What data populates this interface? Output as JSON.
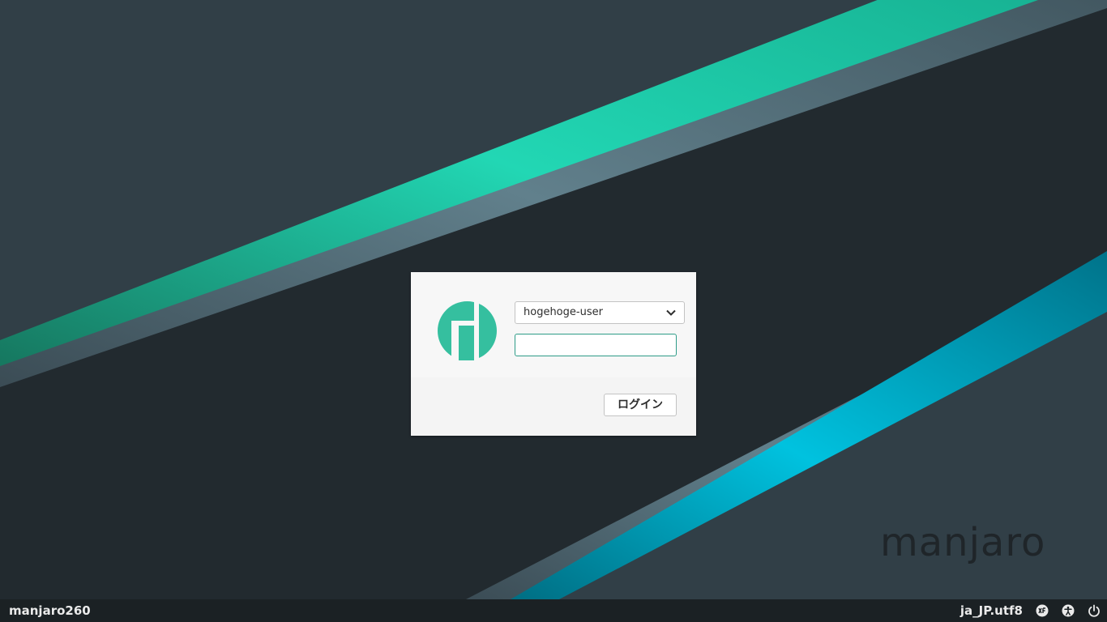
{
  "login": {
    "username": "hogehoge-user",
    "password_value": "",
    "login_label": "ログイン"
  },
  "branding": {
    "wordmark": "manjaro",
    "logo_icon": "manjaro-logo-icon"
  },
  "panel": {
    "hostname": "manjaro260",
    "locale": "ja_JP.utf8",
    "icons": [
      "keyboard-layout-icon",
      "accessibility-icon",
      "power-icon"
    ]
  },
  "colors": {
    "accent_green": "#35bf9f",
    "accent_teal": "#00a6c4",
    "panel_bg": "#1b2124",
    "dialog_bg": "#f4f4f4",
    "focus_border": "#2e9c88"
  }
}
